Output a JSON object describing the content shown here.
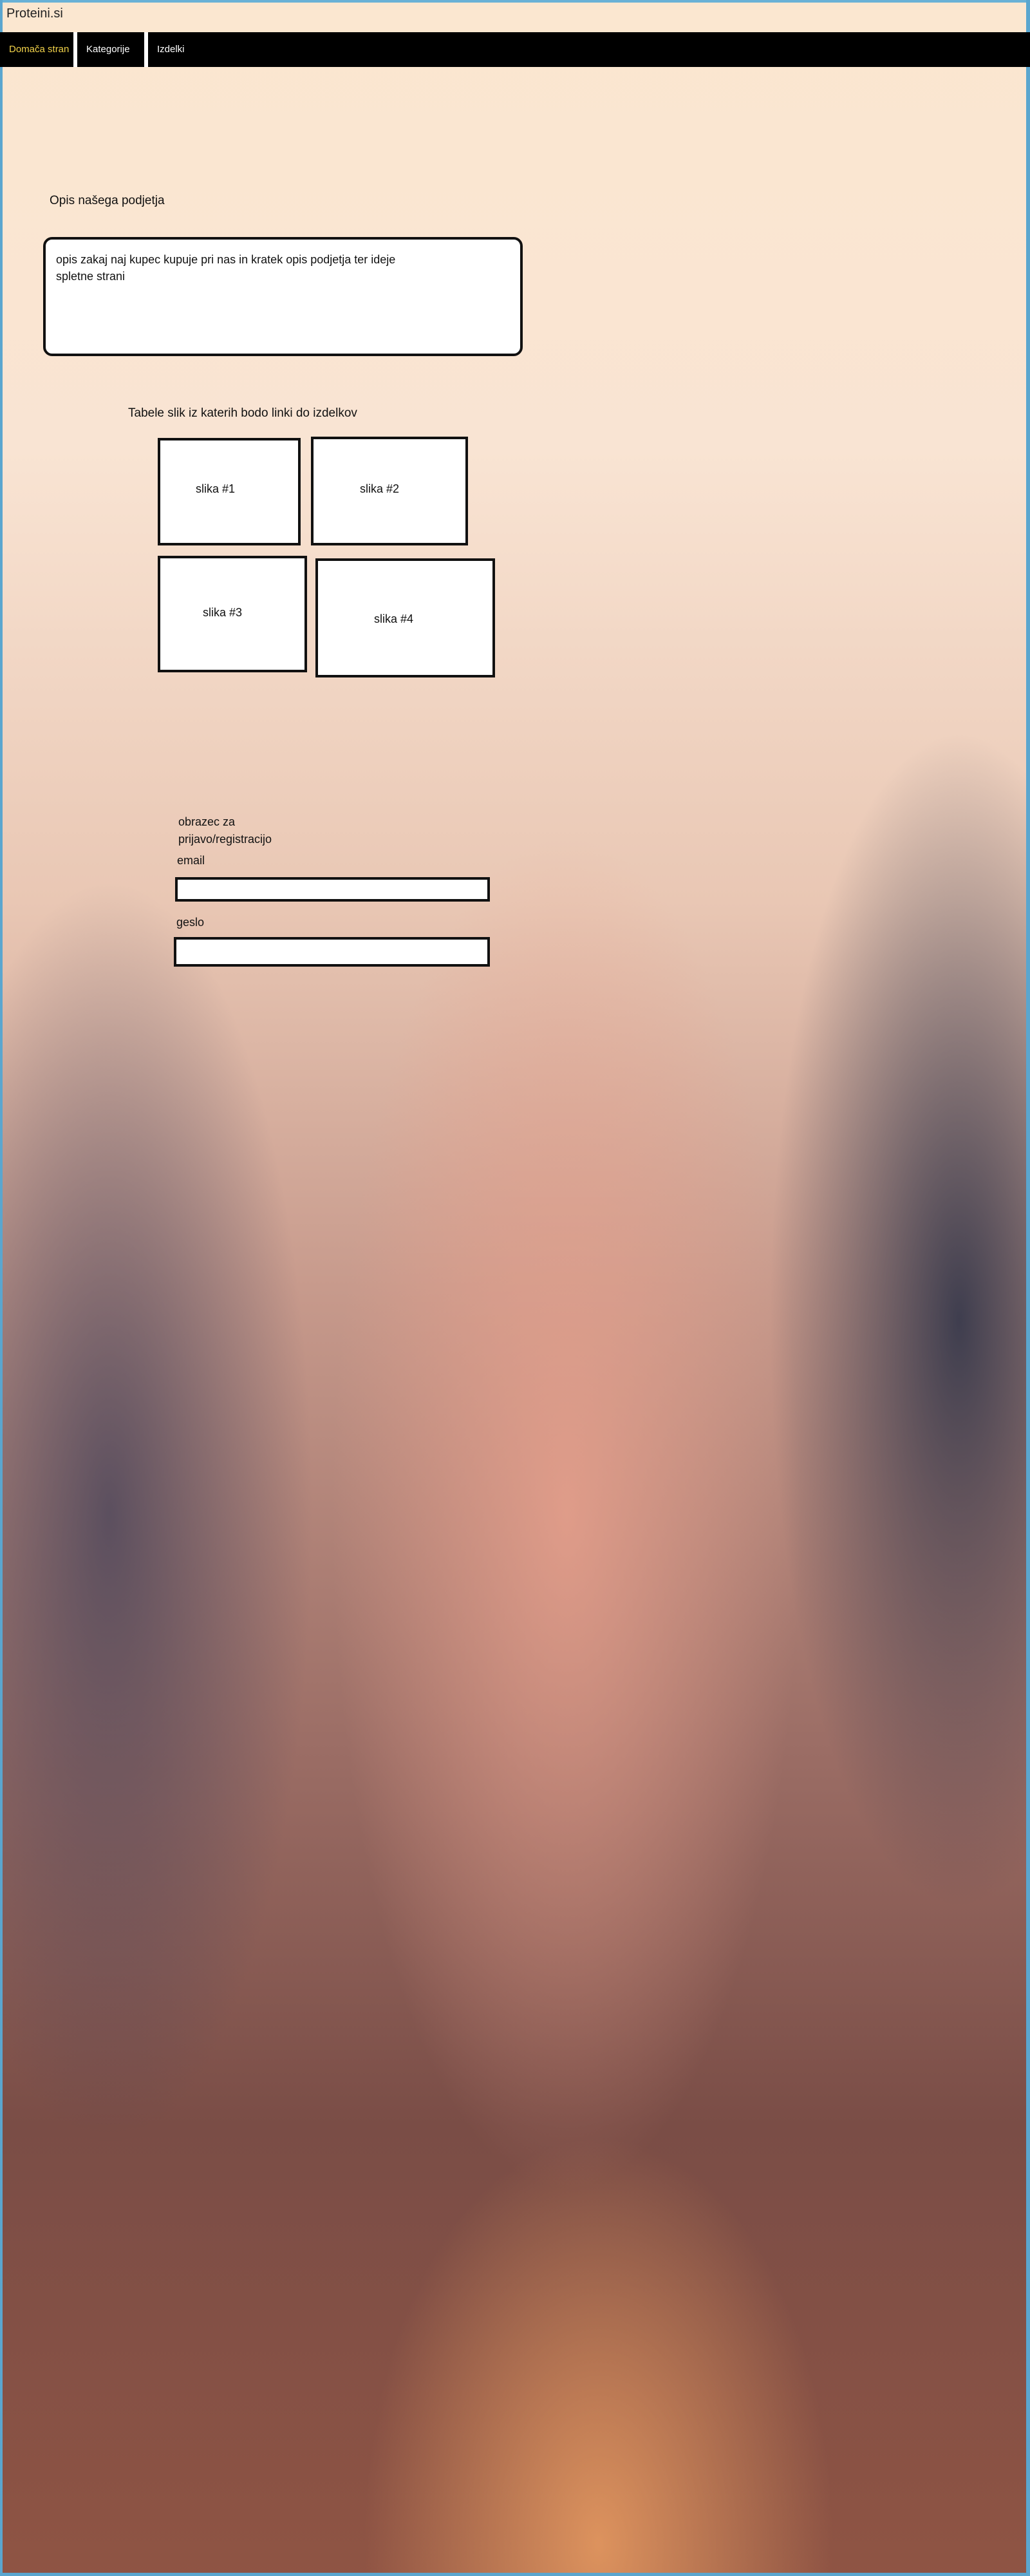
{
  "header": {
    "title": "Proteini.si"
  },
  "nav": {
    "items": [
      {
        "label": "Domača stran",
        "active": true
      },
      {
        "label": "Kategorije",
        "active": false
      },
      {
        "label": "Izdelki",
        "active": false
      }
    ]
  },
  "about": {
    "title": "Opis našega podjetja",
    "text": "opis zakaj naj kupec kupuje pri nas in kratek opis podjetja ter ideje spletne strani"
  },
  "gallery": {
    "title": "Tabele slik iz katerih bodo linki do izdelkov",
    "items": [
      {
        "label": "slika #1"
      },
      {
        "label": "slika #2"
      },
      {
        "label": "slika #3"
      },
      {
        "label": "slika #4"
      }
    ]
  },
  "form": {
    "title_line1": "obrazec za",
    "title_line2": "prijavo/registracijo",
    "email_label": "email",
    "email_value": "",
    "password_label": "geslo",
    "password_value": ""
  },
  "colors": {
    "nav_background": "#000000",
    "nav_active_text": "#f1d24a",
    "frame": "#5aa6cf"
  }
}
